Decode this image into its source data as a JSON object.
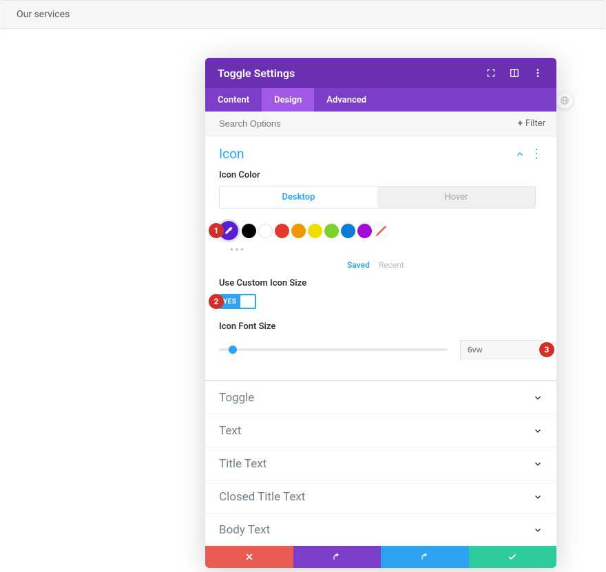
{
  "page_header": "Our services",
  "modal": {
    "title": "Toggle Settings",
    "tabs": {
      "content": "Content",
      "design": "Design",
      "advanced": "Advanced"
    },
    "search_placeholder": "Search Options",
    "filter_label": "Filter"
  },
  "icon_panel": {
    "title": "Icon",
    "icon_color_label": "Icon Color",
    "subtabs": {
      "desktop": "Desktop",
      "hover": "Hover"
    },
    "saved_label": "Saved",
    "recent_label": "Recent",
    "use_custom_label": "Use Custom Icon Size",
    "yes_label": "YES",
    "font_size_label": "Icon Font Size",
    "font_size_value": "6vw"
  },
  "sections": {
    "toggle": "Toggle",
    "text": "Text",
    "title_text": "Title Text",
    "closed_title_text": "Closed Title Text",
    "body_text": "Body Text"
  },
  "badges": {
    "one": "1",
    "two": "2",
    "three": "3"
  }
}
